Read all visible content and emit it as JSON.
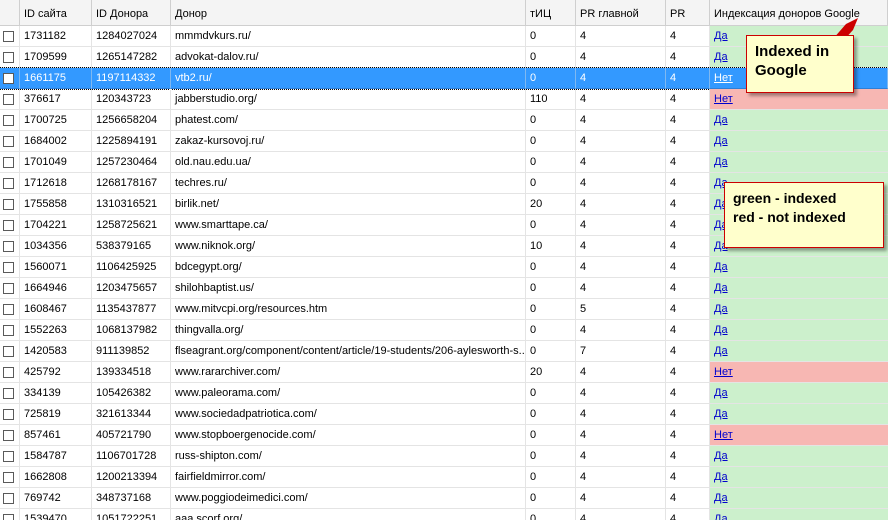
{
  "columns": [
    "",
    "ID сайта",
    "ID Донора",
    "Донор",
    "тИЦ",
    "PR главной",
    "PR",
    "Индексация доноров Google"
  ],
  "rows": [
    {
      "site_id": "1731182",
      "donor_id": "1284027024",
      "donor": "mmmdvkurs.ru/",
      "tic": "0",
      "pr_main": "4",
      "pr": "4",
      "indexed": "Да",
      "status": "ok"
    },
    {
      "site_id": "1709599",
      "donor_id": "1265147282",
      "donor": "advokat-dalov.ru/",
      "tic": "0",
      "pr_main": "4",
      "pr": "4",
      "indexed": "Да",
      "status": "ok"
    },
    {
      "site_id": "1661175",
      "donor_id": "1197114332",
      "donor": "vtb2.ru/",
      "tic": "0",
      "pr_main": "4",
      "pr": "4",
      "indexed": "Нет",
      "status": "no",
      "selected": true
    },
    {
      "site_id": "376617",
      "donor_id": "120343723",
      "donor": "jabberstudio.org/",
      "tic": "110",
      "pr_main": "4",
      "pr": "4",
      "indexed": "Нет",
      "status": "no"
    },
    {
      "site_id": "1700725",
      "donor_id": "1256658204",
      "donor": "phatest.com/",
      "tic": "0",
      "pr_main": "4",
      "pr": "4",
      "indexed": "Да",
      "status": "ok"
    },
    {
      "site_id": "1684002",
      "donor_id": "1225894191",
      "donor": "zakaz-kursovoj.ru/",
      "tic": "0",
      "pr_main": "4",
      "pr": "4",
      "indexed": "Да",
      "status": "ok"
    },
    {
      "site_id": "1701049",
      "donor_id": "1257230464",
      "donor": "old.nau.edu.ua/",
      "tic": "0",
      "pr_main": "4",
      "pr": "4",
      "indexed": "Да",
      "status": "ok"
    },
    {
      "site_id": "1712618",
      "donor_id": "1268178167",
      "donor": "techres.ru/",
      "tic": "0",
      "pr_main": "4",
      "pr": "4",
      "indexed": "Да",
      "status": "ok"
    },
    {
      "site_id": "1755858",
      "donor_id": "1310316521",
      "donor": "birlik.net/",
      "tic": "20",
      "pr_main": "4",
      "pr": "4",
      "indexed": "Да",
      "status": "ok"
    },
    {
      "site_id": "1704221",
      "donor_id": "1258725621",
      "donor": "www.smarttape.ca/",
      "tic": "0",
      "pr_main": "4",
      "pr": "4",
      "indexed": "Да",
      "status": "ok"
    },
    {
      "site_id": "1034356",
      "donor_id": "538379165",
      "donor": "www.niknok.org/",
      "tic": "10",
      "pr_main": "4",
      "pr": "4",
      "indexed": "Да",
      "status": "ok"
    },
    {
      "site_id": "1560071",
      "donor_id": "1106425925",
      "donor": "bdcegypt.org/",
      "tic": "0",
      "pr_main": "4",
      "pr": "4",
      "indexed": "Да",
      "status": "ok"
    },
    {
      "site_id": "1664946",
      "donor_id": "1203475657",
      "donor": "shilohbaptist.us/",
      "tic": "0",
      "pr_main": "4",
      "pr": "4",
      "indexed": "Да",
      "status": "ok"
    },
    {
      "site_id": "1608467",
      "donor_id": "1135437877",
      "donor": "www.mitvcpi.org/resources.htm",
      "tic": "0",
      "pr_main": "5",
      "pr": "4",
      "indexed": "Да",
      "status": "ok"
    },
    {
      "site_id": "1552263",
      "donor_id": "1068137982",
      "donor": "thingvalla.org/",
      "tic": "0",
      "pr_main": "4",
      "pr": "4",
      "indexed": "Да",
      "status": "ok"
    },
    {
      "site_id": "1420583",
      "donor_id": "911139852",
      "donor": "flseagrant.org/component/content/article/19-students/206-aylesworth-s...",
      "tic": "0",
      "pr_main": "7",
      "pr": "4",
      "indexed": "Да",
      "status": "ok"
    },
    {
      "site_id": "425792",
      "donor_id": "139334518",
      "donor": "www.rararchiver.com/",
      "tic": "20",
      "pr_main": "4",
      "pr": "4",
      "indexed": "Нет",
      "status": "no"
    },
    {
      "site_id": "334139",
      "donor_id": "105426382",
      "donor": "www.paleorama.com/",
      "tic": "0",
      "pr_main": "4",
      "pr": "4",
      "indexed": "Да",
      "status": "ok"
    },
    {
      "site_id": "725819",
      "donor_id": "321613344",
      "donor": "www.sociedadpatriotica.com/",
      "tic": "0",
      "pr_main": "4",
      "pr": "4",
      "indexed": "Да",
      "status": "ok"
    },
    {
      "site_id": "857461",
      "donor_id": "405721790",
      "donor": "www.stopboergenocide.com/",
      "tic": "0",
      "pr_main": "4",
      "pr": "4",
      "indexed": "Нет",
      "status": "no"
    },
    {
      "site_id": "1584787",
      "donor_id": "1106701728",
      "donor": "russ-shipton.com/",
      "tic": "0",
      "pr_main": "4",
      "pr": "4",
      "indexed": "Да",
      "status": "ok"
    },
    {
      "site_id": "1662808",
      "donor_id": "1200213394",
      "donor": "fairfieldmirror.com/",
      "tic": "0",
      "pr_main": "4",
      "pr": "4",
      "indexed": "Да",
      "status": "ok"
    },
    {
      "site_id": "769742",
      "donor_id": "348737168",
      "donor": "www.poggiodeimedici.com/",
      "tic": "0",
      "pr_main": "4",
      "pr": "4",
      "indexed": "Да",
      "status": "ok"
    },
    {
      "site_id": "1539470",
      "donor_id": "1051722251",
      "donor": "aaa.scorf.org/",
      "tic": "0",
      "pr_main": "4",
      "pr": "4",
      "indexed": "Да",
      "status": "ok"
    }
  ],
  "callouts": {
    "indexed": "Indexed in Google",
    "legend_green": "green - indexed",
    "legend_red": "red - not indexed"
  },
  "colors": {
    "indexed_bg": "#ccf0cc",
    "not_indexed_bg": "#f7b7b3",
    "selection": "#3399ff",
    "callout_border": "#cc0000",
    "callout_bg": "#ffffcc"
  }
}
